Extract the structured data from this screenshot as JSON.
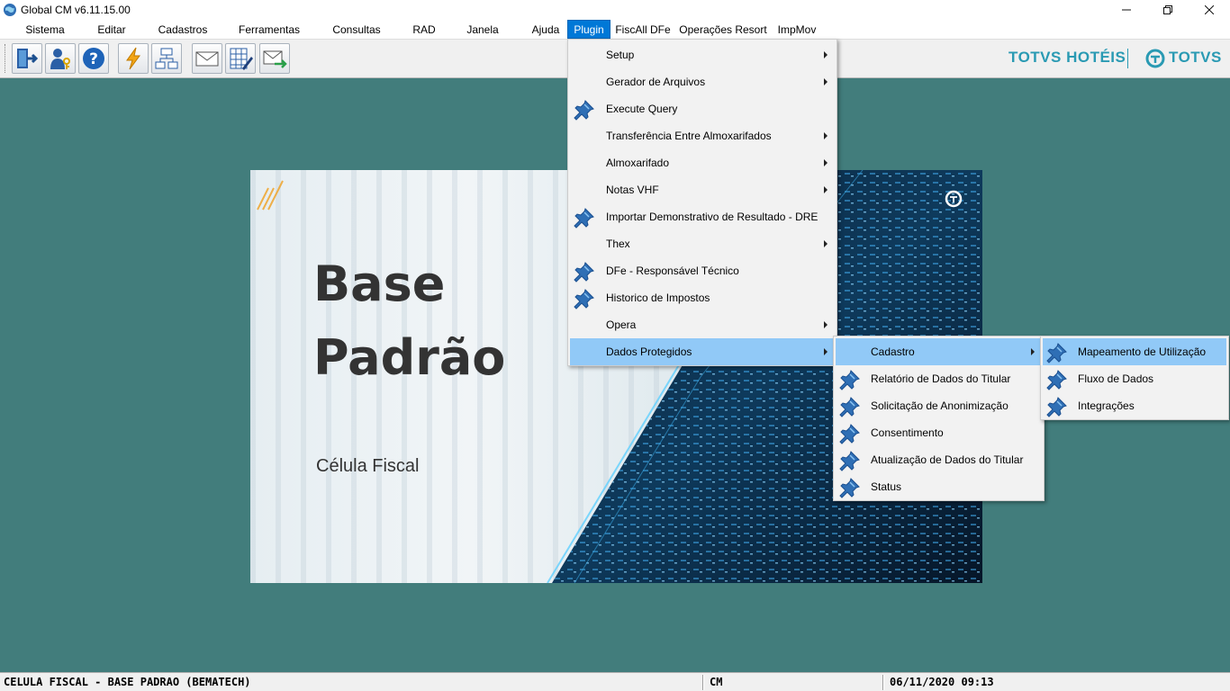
{
  "window": {
    "title": "Global CM v6.11.15.00"
  },
  "menubar": [
    {
      "label": "Sistema"
    },
    {
      "label": "Editar"
    },
    {
      "label": "Cadastros"
    },
    {
      "label": "Ferramentas"
    },
    {
      "label": "Consultas"
    },
    {
      "label": "RAD"
    },
    {
      "label": "Janela"
    },
    {
      "label": "Ajuda"
    },
    {
      "label": "Plugin"
    },
    {
      "label": "FiscAll DFe"
    },
    {
      "label": "Operações Resort"
    },
    {
      "label": "ImpMov"
    }
  ],
  "toolbar": {
    "icons": [
      "exit-icon",
      "user-key-icon",
      "help-icon",
      "lightning-icon",
      "network-icon",
      "mail-icon",
      "spreadsheet-edit-icon",
      "mail-send-icon"
    ]
  },
  "brand": {
    "left": "TOTVS HOTÉIS",
    "right": "TOTVS"
  },
  "banner": {
    "line1": "Base",
    "line2": "Padrão",
    "subtitle": "Célula Fiscal"
  },
  "plugin_menu": [
    {
      "label": "Setup",
      "submenu": true,
      "pin": false
    },
    {
      "label": "Gerador de Arquivos",
      "submenu": true,
      "pin": false
    },
    {
      "label": "Execute Query",
      "submenu": false,
      "pin": true
    },
    {
      "label": "Transferência Entre Almoxarifados",
      "submenu": true,
      "pin": false
    },
    {
      "label": "Almoxarifado",
      "submenu": true,
      "pin": false
    },
    {
      "label": "Notas VHF",
      "submenu": true,
      "pin": false
    },
    {
      "label": "Importar Demonstrativo de Resultado - DRE",
      "submenu": false,
      "pin": true
    },
    {
      "label": "Thex",
      "submenu": true,
      "pin": false
    },
    {
      "label": "DFe - Responsável Técnico",
      "submenu": false,
      "pin": true
    },
    {
      "label": "Historico de Impostos",
      "submenu": false,
      "pin": true
    },
    {
      "label": "Opera",
      "submenu": true,
      "pin": false
    },
    {
      "label": "Dados Protegidos",
      "submenu": true,
      "pin": false,
      "highlighted": true
    }
  ],
  "dados_protegidos_menu": [
    {
      "label": "Cadastro",
      "submenu": true,
      "pin": false,
      "highlighted": true
    },
    {
      "label": "Relatório de Dados do Titular",
      "submenu": false,
      "pin": true
    },
    {
      "label": "Solicitação de Anonimização",
      "submenu": false,
      "pin": true
    },
    {
      "label": "Consentimento",
      "submenu": false,
      "pin": true
    },
    {
      "label": "Atualização de Dados do Titular",
      "submenu": false,
      "pin": true
    },
    {
      "label": "Status",
      "submenu": false,
      "pin": true
    }
  ],
  "cadastro_menu": [
    {
      "label": "Mapeamento de Utilização",
      "pin": true,
      "highlighted": true
    },
    {
      "label": "Fluxo de Dados",
      "pin": true
    },
    {
      "label": "Integrações",
      "pin": true
    }
  ],
  "statusbar": {
    "database": "CELULA FISCAL - BASE PADRAO (BEMATECH)",
    "module": "CM",
    "datetime": "06/11/2020 09:13"
  },
  "colors": {
    "workspace": "#427d7c",
    "menu_highlight": "#91c9f7",
    "active_menu": "#0078d7",
    "brand": "#2a9ab3"
  }
}
